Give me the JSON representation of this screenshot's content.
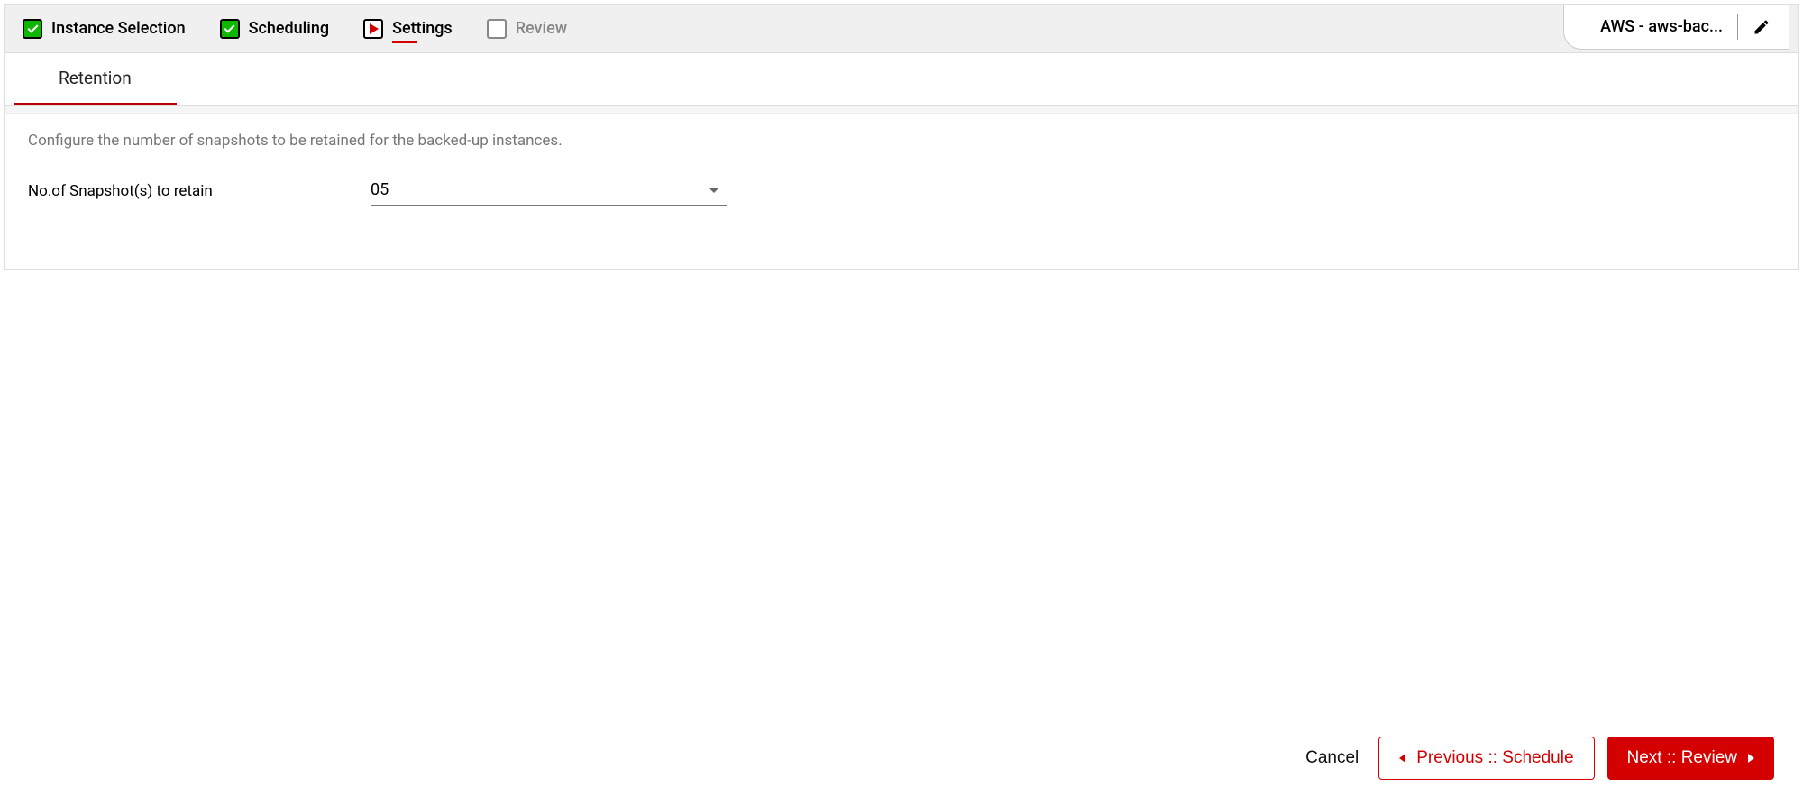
{
  "stepper": {
    "steps": [
      {
        "label": "Instance Selection",
        "state": "completed"
      },
      {
        "label": "Scheduling",
        "state": "completed"
      },
      {
        "label": "Settings",
        "state": "current"
      },
      {
        "label": "Review",
        "state": "pending"
      }
    ]
  },
  "account": {
    "label": "AWS - aws-bac..."
  },
  "tabs": [
    {
      "label": "Retention",
      "active": true
    }
  ],
  "content": {
    "description": "Configure the number of snapshots to be retained for the backed-up instances.",
    "snapshot_label": "No.of Snapshot(s) to retain",
    "snapshot_value": "05"
  },
  "footer": {
    "cancel": "Cancel",
    "previous": "Previous :: Schedule",
    "next": "Next :: Review"
  }
}
